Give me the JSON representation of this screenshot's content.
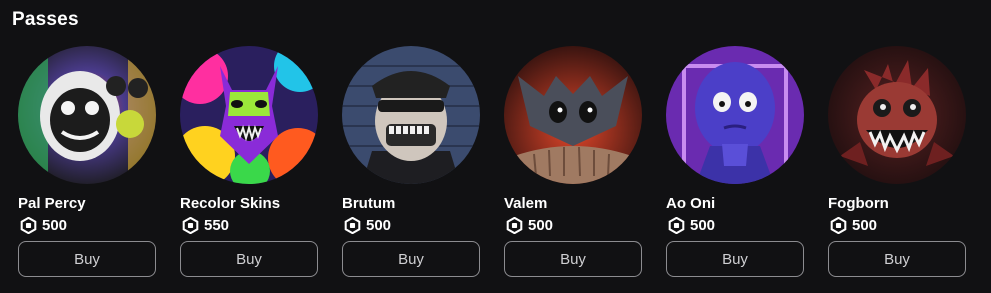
{
  "section": {
    "title": "Passes"
  },
  "passes": [
    {
      "name": "Pal Percy",
      "price": "500",
      "buy_label": "Buy",
      "thumbnail_icon": "pal-percy-thumbnail-icon"
    },
    {
      "name": "Recolor Skins",
      "price": "550",
      "buy_label": "Buy",
      "thumbnail_icon": "recolor-skins-thumbnail-icon"
    },
    {
      "name": "Brutum",
      "price": "500",
      "buy_label": "Buy",
      "thumbnail_icon": "brutum-thumbnail-icon"
    },
    {
      "name": "Valem",
      "price": "500",
      "buy_label": "Buy",
      "thumbnail_icon": "valem-thumbnail-icon"
    },
    {
      "name": "Ao Oni",
      "price": "500",
      "buy_label": "Buy",
      "thumbnail_icon": "ao-oni-thumbnail-icon"
    },
    {
      "name": "Fogborn",
      "price": "500",
      "buy_label": "Buy",
      "thumbnail_icon": "fogborn-thumbnail-icon"
    }
  ],
  "colors": {
    "background": "#111113",
    "text": "#ffffff",
    "button_border": "#8c8c90",
    "button_text": "#cfcfd2"
  }
}
